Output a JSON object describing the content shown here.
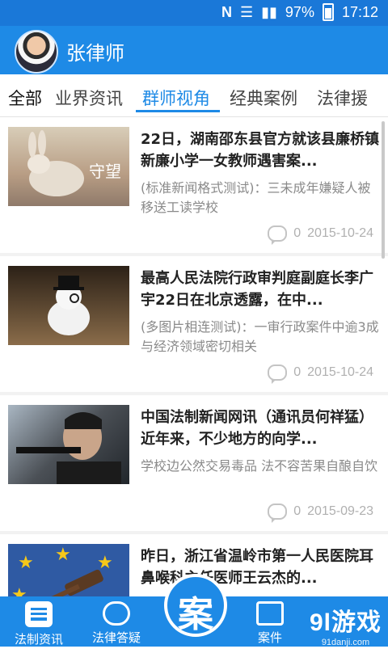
{
  "status_bar": {
    "battery_percent": "97%",
    "time": "17:12",
    "icons": [
      "n-icon",
      "wifi-icon",
      "signal-icon",
      "battery-icon"
    ]
  },
  "header": {
    "title": "张律师",
    "avatar_icon": "avatar"
  },
  "tabs": [
    {
      "label": "全部"
    },
    {
      "label": "业界资讯"
    },
    {
      "label": "群师视角"
    },
    {
      "label": "经典案例"
    },
    {
      "label": "法律援"
    }
  ],
  "articles": [
    {
      "title": "22日，湖南邵东县官方就该县廉桥镇新廉小学一女教师遇害案...",
      "desc": "(标准新闻格式测试)：三未成年嫌疑人被移送工读学校",
      "comments": "0",
      "date": "2015-10-24"
    },
    {
      "title": "最高人民法院行政审判庭副庭长李广宇22日在北京透露，在中...",
      "desc": "(多图片相连测试)：一审行政案件中逾3成与经济领域密切相关",
      "comments": "0",
      "date": "2015-10-24"
    },
    {
      "title": " 中国法制新闻网讯（通讯员何祥猛）近年来，不少地方的向学...",
      "desc": "学校边公然交易毒品 法不容苦果自酿自饮",
      "comments": "0",
      "date": "2015-09-23"
    },
    {
      "title": " 昨日，浙江省温岭市第一人民医院耳鼻喉科主任医师王云杰的...",
      "desc": "",
      "comments": "",
      "date": ""
    }
  ],
  "bottom_nav": [
    {
      "label": "法制资讯"
    },
    {
      "label": "法律答疑"
    },
    {
      "label": "案"
    },
    {
      "label": "案件"
    }
  ],
  "watermark": {
    "big": "9l游戏",
    "small": "91danji.com"
  },
  "colors": {
    "primary": "#1e8ae6",
    "statusbar": "#1a78d8"
  }
}
